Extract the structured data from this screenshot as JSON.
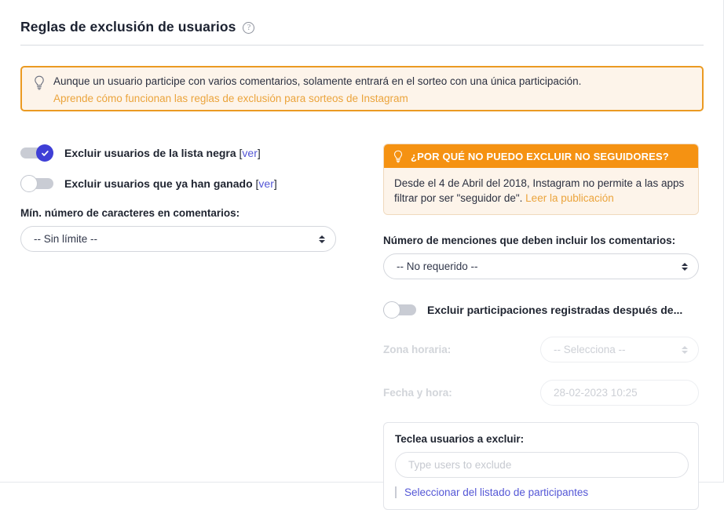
{
  "header": {
    "title": "Reglas de exclusión de usuarios",
    "help_icon": "question-circle-icon"
  },
  "notice": {
    "icon": "lightbulb-icon",
    "text": "Aunque un usuario participe con varios comentarios, solamente entrará en el sorteo con una única participación.",
    "link": "Aprende cómo funcionan las reglas de exclusión para sorteos de Instagram",
    "border_color": "#eb9a22",
    "background_color": "#fdf4ea",
    "link_color": "#eba43c"
  },
  "left": {
    "toggle_blacklist": {
      "label": "Excluir usuarios de la lista negra",
      "bracket_open": "[",
      "link": "ver",
      "bracket_close": "]",
      "state": "on"
    },
    "toggle_winners": {
      "label": "Excluir usuarios que ya han ganado",
      "bracket_open": "[",
      "link": "ver",
      "bracket_close": "]",
      "state": "off"
    },
    "min_chars": {
      "label": "Mín. número de caracteres en comentarios:",
      "value": "-- Sin límite --"
    }
  },
  "right": {
    "info_card": {
      "icon": "lightbulb-icon",
      "title": "¿POR QUÉ NO PUEDO EXCLUIR NO SEGUIDORES?",
      "body": "Desde el 4 de Abril del 2018, Instagram no permite a las apps filtrar por ser \"seguidor de\".",
      "link": "Leer la publicación",
      "header_color": "#f59212",
      "link_color": "#eba43c"
    },
    "mentions": {
      "label": "Número de menciones que deben incluir los comentarios:",
      "value": "-- No requerido --"
    },
    "toggle_after_date": {
      "label": "Excluir participaciones registradas después de...",
      "state": "off"
    },
    "timezone": {
      "label": "Zona horaria:",
      "value": "-- Selecciona --",
      "disabled": true
    },
    "datetime": {
      "label": "Fecha y hora:",
      "value": "28-02-2023 10:25",
      "disabled": true
    },
    "exclude_users": {
      "label": "Teclea usuarios a excluir:",
      "placeholder": "Type users to exclude",
      "value": "",
      "action_link": "Seleccionar del listado de participantes",
      "action_link_color": "#5457d6"
    }
  },
  "colors": {
    "accent_blue": "#5457d6",
    "toggle_on": "#3f3fd6",
    "orange": "#f59212",
    "text": "#1f2430"
  }
}
